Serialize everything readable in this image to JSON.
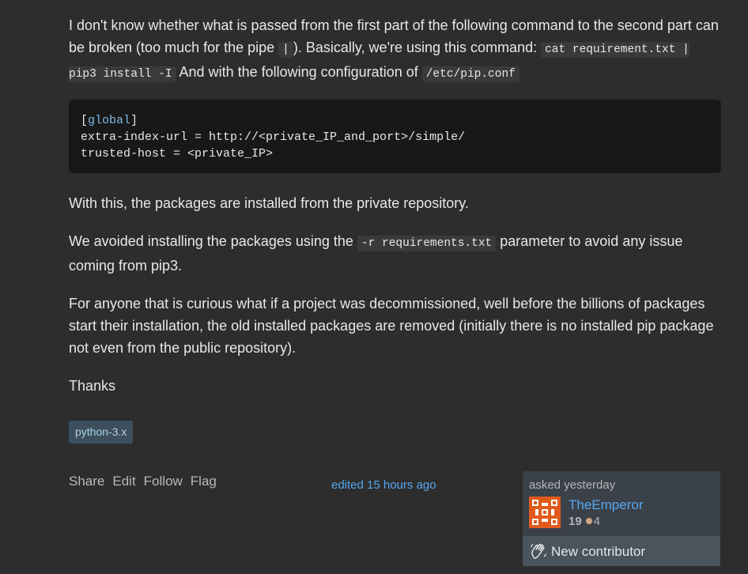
{
  "post": {
    "p1_a": "I don't know whether what is passed from the first part of the following command to the second part can be broken (too much for the pipe ",
    "pipe_code": "|",
    "p1_b": "). Basically, we're using this command: ",
    "cmd_code": "cat requirement.txt | pip3 install -I",
    "p1_c": " And with the following configuration of ",
    "conf_code": "/etc/pip.conf",
    "code_line1_open": "[",
    "code_line1_kw": "global",
    "code_line1_close": "]",
    "code_line2": "extra-index-url = http://<private_IP_and_port>/simple/",
    "code_line3": "trusted-host = <private_IP>",
    "p2": "With this, the packages are installed from the private repository.",
    "p3_a": "We avoided installing the packages using the ",
    "p3_code": "-r requirements.txt",
    "p3_b": " parameter to avoid any issue coming from pip3.",
    "p4": "For anyone that is curious what if a project was decommissioned, well before the billions of packages start their installation, the old installed packages are removed (initially there is no installed pip package not even from the public repository).",
    "p5": "Thanks"
  },
  "tags": [
    "python-3.x"
  ],
  "menu": {
    "share": "Share",
    "edit": "Edit",
    "follow": "Follow",
    "flag": "Flag"
  },
  "edited": "edited 15 hours ago",
  "card": {
    "asked": "asked yesterday",
    "user": "TheEmperor",
    "rep": "19",
    "bronze": "4",
    "new_contributor": "New contributor"
  },
  "colors": {
    "link": "#55a7f0",
    "tag_bg": "#3d4f5c",
    "tag_text": "#a9d0ea",
    "avatar": "#e05a1c"
  }
}
